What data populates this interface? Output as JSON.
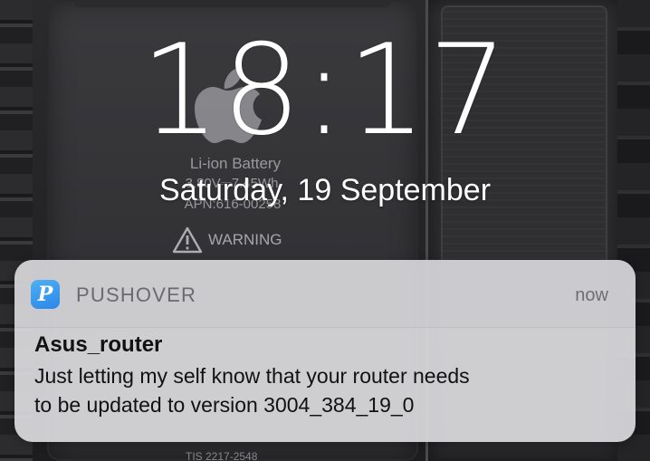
{
  "lockscreen": {
    "time": "18:17",
    "date": "Saturday, 19 September"
  },
  "wallpaper": {
    "battery_label": "Li-ion Battery",
    "battery_spec": "3.80V⎓7.45Wh",
    "battery_apn": "APN:616-00258",
    "warning_label": "WARNING",
    "tis_label": "TIS 2217-2548",
    "icons": [
      "apple-logo",
      "warning-icon"
    ]
  },
  "notification": {
    "app_name": "PUSHOVER",
    "app_icon_letter": "P",
    "time": "now",
    "title": "Asus_router",
    "body_line1": "Just letting my self know that your router needs",
    "body_line2": "to be updated to version 3004_384_19_0",
    "icon": "pushover-icon",
    "icon_color": "#2a86e8"
  }
}
